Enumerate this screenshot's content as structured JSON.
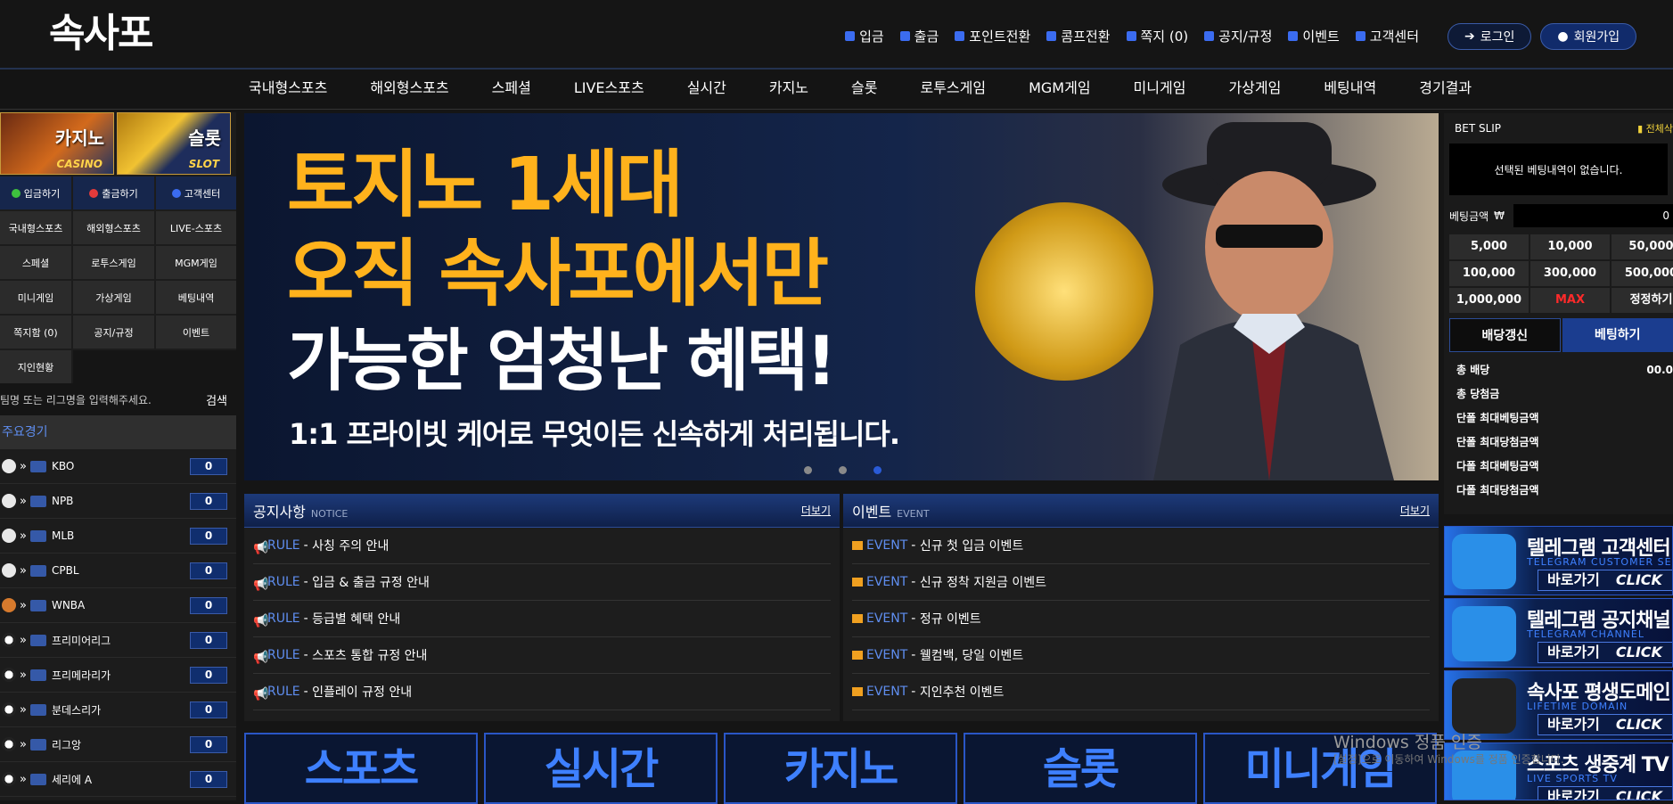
{
  "logo": {
    "text": "속사포"
  },
  "top_links": [
    "입금",
    "출금",
    "포인트전환",
    "콤프전환",
    "쪽지 (0)",
    "공지/규정",
    "이벤트",
    "고객센터"
  ],
  "auth": {
    "login": "로그인",
    "join": "회원가입"
  },
  "main_nav": [
    "국내형스포츠",
    "해외형스포츠",
    "스페셜",
    "LIVE스포츠",
    "실시간",
    "카지노",
    "슬롯",
    "로투스게임",
    "MGM게임",
    "미니게임",
    "가상게임",
    "베팅내역",
    "경기결과"
  ],
  "sidebar": {
    "casino": {
      "ko": "카지노",
      "en": "CASINO"
    },
    "slot": {
      "ko": "슬롯",
      "en": "SLOT"
    },
    "quick": [
      "입금하기",
      "출금하기",
      "고객센터"
    ],
    "menu": [
      "국내형스포츠",
      "해외형스포츠",
      "LIVE-스포츠",
      "스페셜",
      "로투스게임",
      "MGM게임",
      "미니게임",
      "가상게임",
      "베팅내역",
      "쪽지함 (0)",
      "공지/규정",
      "이벤트",
      "지인현황"
    ],
    "search_placeholder": "팀명 또는 리그명을 입력해주세요.",
    "search_btn": "검색",
    "major_title": "주요경기",
    "leagues": [
      {
        "name": "KBO",
        "count": "0"
      },
      {
        "name": "NPB",
        "count": "0"
      },
      {
        "name": "MLB",
        "count": "0"
      },
      {
        "name": "CPBL",
        "count": "0"
      },
      {
        "name": "WNBA",
        "count": "0"
      },
      {
        "name": "프리미어리그",
        "count": "0"
      },
      {
        "name": "프리메라리가",
        "count": "0"
      },
      {
        "name": "분데스리가",
        "count": "0"
      },
      {
        "name": "리그앙",
        "count": "0"
      },
      {
        "name": "세리에 A",
        "count": "0"
      }
    ]
  },
  "banner": {
    "line1": "토지노 1세대",
    "line2": "오직 속사포에서만",
    "line3": "가능한 엄청난 혜택!",
    "line4": "1:1 프라이빗 케어로 무엇이든 신속하게 처리됩니다."
  },
  "notice": {
    "title": "공지사항",
    "sub": "NOTICE",
    "more": "더보기",
    "items": [
      {
        "tag": "RULE",
        "text": "사칭 주의 안내"
      },
      {
        "tag": "RULE",
        "text": "입금 & 출금 규정 안내"
      },
      {
        "tag": "RULE",
        "text": "등급별 혜택 안내"
      },
      {
        "tag": "RULE",
        "text": "스포츠 통합 규정 안내"
      },
      {
        "tag": "RULE",
        "text": "인플레이 규정 안내"
      }
    ]
  },
  "event": {
    "title": "이벤트",
    "sub": "EVENT",
    "more": "더보기",
    "items": [
      {
        "tag": "EVENT",
        "text": "신규 첫 입금 이벤트"
      },
      {
        "tag": "EVENT",
        "text": "신규 정착 지원금 이벤트"
      },
      {
        "tag": "EVENT",
        "text": "정규 이벤트"
      },
      {
        "tag": "EVENT",
        "text": "웰컴백, 당일 이벤트"
      },
      {
        "tag": "EVENT",
        "text": "지인추천 이벤트"
      }
    ]
  },
  "tiles": [
    "스포츠",
    "실시간",
    "카지노",
    "슬롯",
    "미니게임"
  ],
  "betslip": {
    "title": "BET SLIP",
    "delete_all": "전체삭",
    "empty": "선택된 베팅내역이 없습니다.",
    "amount_label": "베팅금액",
    "amount_value": "0",
    "chips": [
      "5,000",
      "10,000",
      "50,000",
      "100,000",
      "300,000",
      "500,000",
      "1,000,000",
      "MAX",
      "정정하기"
    ],
    "refresh": "배당갱신",
    "bet": "베팅하기",
    "info": [
      {
        "label": "총 배당",
        "value": "00.0"
      },
      {
        "label": "총 당첨금",
        "value": ""
      },
      {
        "label": "단폴 최대베팅금액",
        "value": ""
      },
      {
        "label": "단폴 최대당첨금액",
        "value": ""
      },
      {
        "label": "다폴 최대베팅금액",
        "value": ""
      },
      {
        "label": "다폴 최대당첨금액",
        "value": ""
      }
    ]
  },
  "promos": [
    {
      "title": "텔레그램 고객센터",
      "sub": "TELEGRAM CUSTOMER SERVI",
      "go": "바로가기",
      "click": "CLICK"
    },
    {
      "title": "텔레그램 공지채널",
      "sub": "TELEGRAM CHANNEL",
      "go": "바로가기",
      "click": "CLICK"
    },
    {
      "title": "속사포 평생도메인",
      "sub": "LIFETIME DOMAIN",
      "go": "바로가기",
      "click": "CLICK"
    },
    {
      "title": "스포츠 생중계 TV",
      "sub": "LIVE SPORTS TV",
      "go": "바로가기",
      "click": "CLICK"
    }
  ],
  "watermark": {
    "line1": "Windows 정품 인증",
    "line2": "[설정]으로 이동하여 Windows를 정품 인증합니다."
  }
}
